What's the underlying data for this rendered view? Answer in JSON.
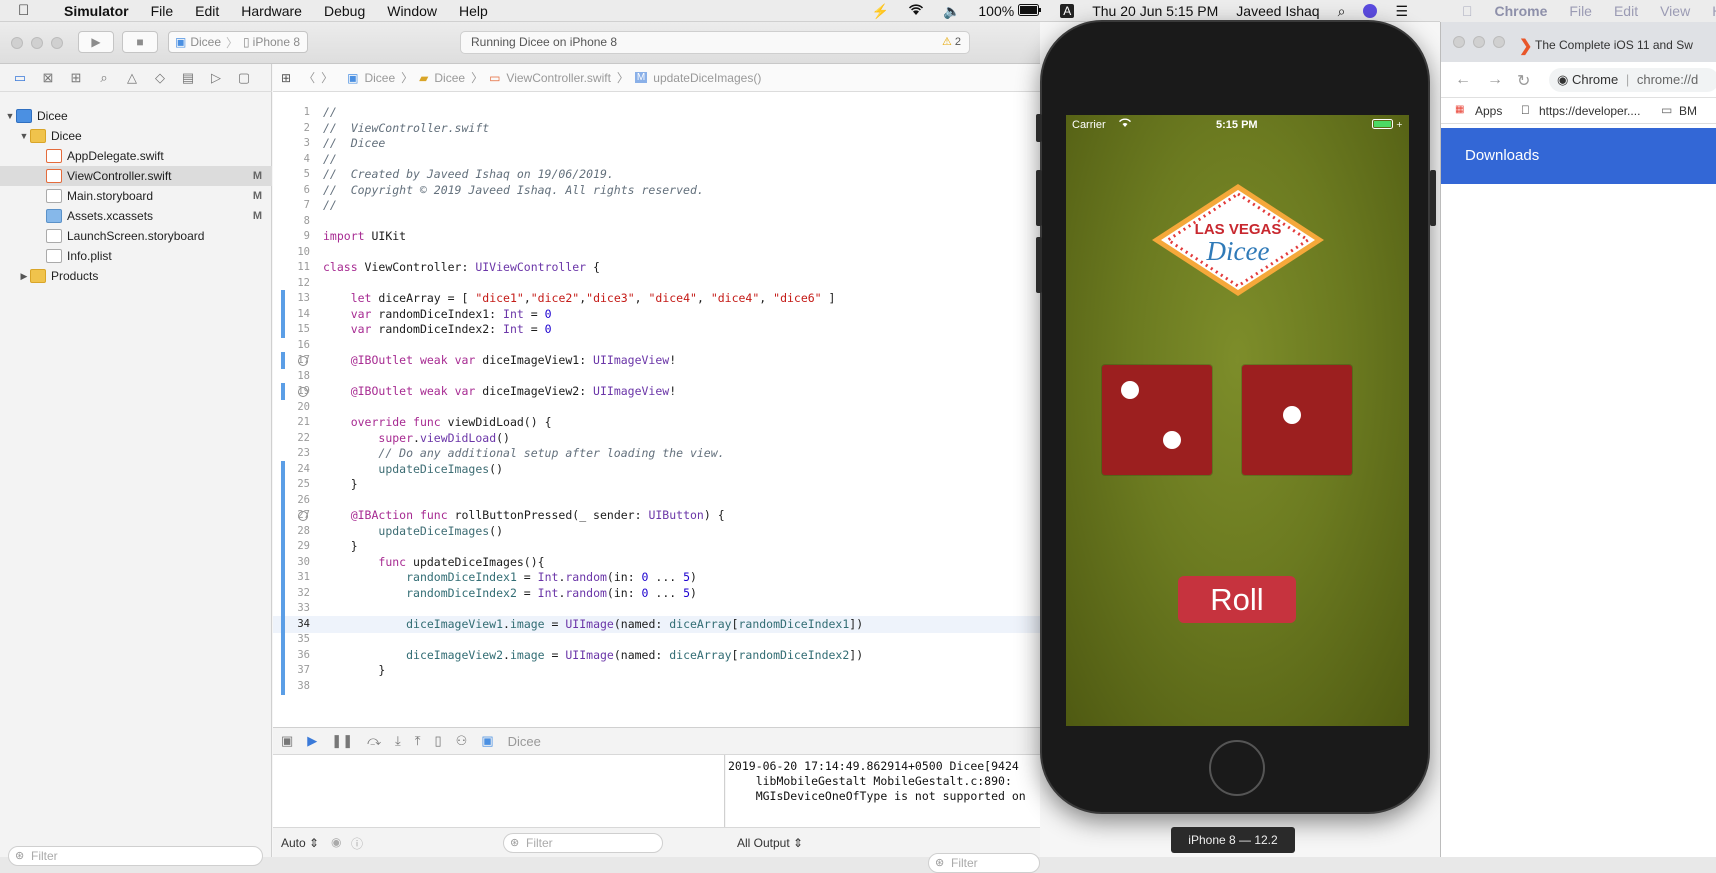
{
  "menubar": {
    "app": "Simulator",
    "items": [
      "File",
      "Edit",
      "Hardware",
      "Debug",
      "Window",
      "Help"
    ],
    "battery": "100%",
    "input_source": "A",
    "datetime": "Thu 20 Jun  5:15 PM",
    "user": "Javeed Ishaq"
  },
  "chrome_menu": {
    "app": "Chrome",
    "items": [
      "File",
      "Edit",
      "View",
      "Hi"
    ]
  },
  "xcode": {
    "scheme": "Dicee",
    "device": "iPhone 8",
    "activity": "Running Dicee on iPhone 8",
    "warnings": "2",
    "jumpbar": [
      "Dicee",
      "Dicee",
      "ViewController.swift",
      "updateDiceImages()"
    ],
    "navigator": [
      {
        "label": "Dicee",
        "badge": ""
      },
      {
        "label": "Dicee",
        "badge": ""
      },
      {
        "label": "AppDelegate.swift",
        "badge": ""
      },
      {
        "label": "ViewController.swift",
        "badge": "M"
      },
      {
        "label": "Main.storyboard",
        "badge": "M"
      },
      {
        "label": "Assets.xcassets",
        "badge": "M"
      },
      {
        "label": "LaunchScreen.storyboard",
        "badge": ""
      },
      {
        "label": "Info.plist",
        "badge": ""
      },
      {
        "label": "Products",
        "badge": ""
      }
    ],
    "filter_placeholder": "Filter",
    "debug_target": "Dicee",
    "auto_label": "Auto",
    "all_output": "All Output",
    "console": "2019-06-20 17:14:49.862914+0500 Dicee[9424\n    libMobileGestalt MobileGestalt.c:890:\n    MGIsDeviceOneOfType is not supported on"
  },
  "code": {
    "current_line": 34
  },
  "simulator": {
    "carrier": "Carrier",
    "time": "5:15 PM",
    "logo_top": "LAS VEGAS",
    "logo_bottom": "Dicee",
    "roll_label": "Roll",
    "device_label": "iPhone 8 — 12.2",
    "die1_value": 2,
    "die2_value": 1
  },
  "chrome": {
    "tab_title": "The Complete iOS 11 and Sw",
    "omnibox_label": "Chrome",
    "omnibox_url": "chrome://d",
    "bookmarks": [
      "Apps",
      "https://developer....",
      "BM"
    ],
    "downloads_title": "Downloads"
  },
  "colors": {
    "felt_green": "#6b7a20",
    "die_red": "#9c1f1f",
    "roll_red": "#c6333e",
    "downloads_blue": "#3367d6"
  }
}
